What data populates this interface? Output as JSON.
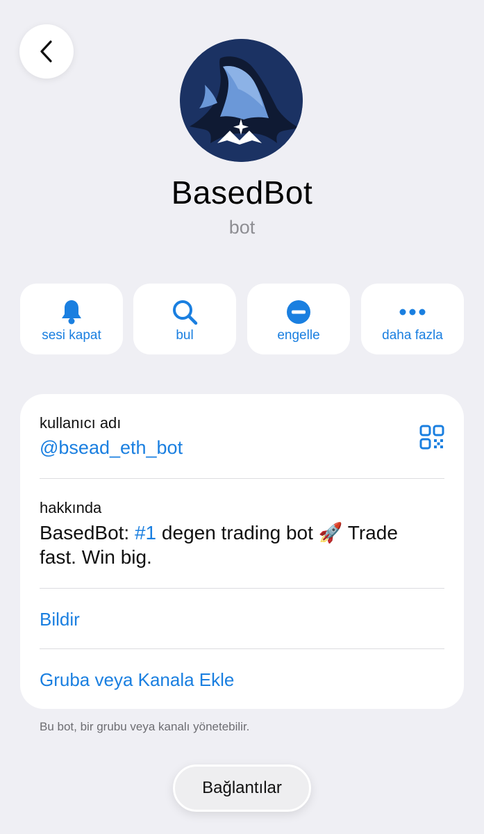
{
  "header": {
    "back_icon": "chevron-left-icon"
  },
  "profile": {
    "avatar_icon": "basedbot-avatar",
    "name": "BasedBot",
    "subtitle": "bot"
  },
  "actions": [
    {
      "label": "sesi kapat",
      "icon": "bell-icon"
    },
    {
      "label": "bul",
      "icon": "search-icon"
    },
    {
      "label": "engelle",
      "icon": "block-icon"
    },
    {
      "label": "daha fazla",
      "icon": "more-icon"
    }
  ],
  "info": {
    "username_label": "kullanıcı adı",
    "username_value": "@bsead_eth_bot",
    "qr_icon": "qr-code-icon",
    "about_label": "hakkında",
    "about_prefix": "BasedBot: ",
    "about_tag": "#1",
    "about_suffix": " degen trading bot 🚀 Trade fast. Win big.",
    "report_label": "Bildir",
    "add_label": "Gruba veya Kanala Ekle"
  },
  "footnote": "Bu bot, bir grubu veya kanalı yönetebilir.",
  "links_button": "Bağlantılar",
  "colors": {
    "accent": "#1a7fe0",
    "background": "#efeff4",
    "avatar_bg": "#1b3263"
  }
}
